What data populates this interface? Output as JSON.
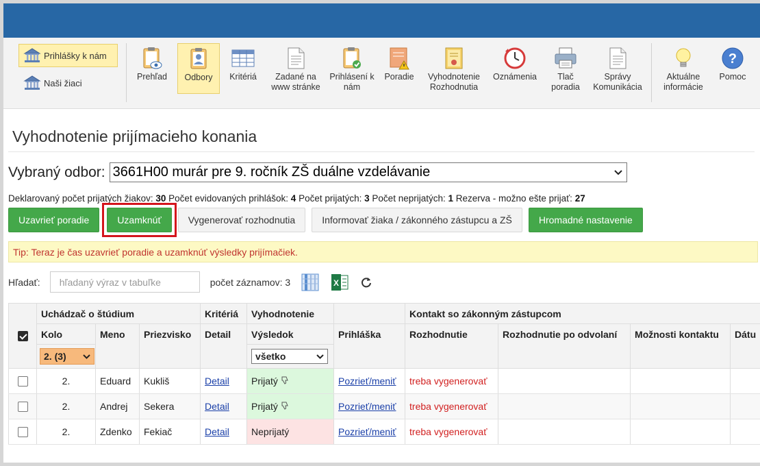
{
  "sidebar": {
    "items": [
      {
        "label": "Prihlášky k nám",
        "active": true
      },
      {
        "label": "Naši žiaci",
        "active": false
      }
    ]
  },
  "toolbar": {
    "items": [
      {
        "label": "Prehľad",
        "icon": "clipboard-eye-icon"
      },
      {
        "label": "Odbory",
        "icon": "clipboard-user-icon",
        "active": true
      },
      {
        "label": "Kritériá",
        "icon": "table-grid-icon"
      },
      {
        "label": "Zadané na www stránke",
        "icon": "document-icon"
      },
      {
        "label": "Prihlásení k nám",
        "icon": "clipboard-check-icon"
      },
      {
        "label": "Poradie",
        "icon": "warning-document-icon"
      },
      {
        "label": "Vyhodnotenie Rozhodnutia",
        "icon": "certificate-icon"
      },
      {
        "label": "Oznámenia",
        "icon": "clock-icon"
      },
      {
        "label": "Tlač poradia",
        "icon": "printer-icon"
      },
      {
        "label": "Správy Komunikácia",
        "icon": "document-icon"
      },
      {
        "label": "Aktuálne informácie",
        "icon": "lightbulb-icon"
      },
      {
        "label": "Pomoc",
        "icon": "help-icon"
      }
    ]
  },
  "page": {
    "title": "Vyhodnotenie prijímacieho konania",
    "odbor_label": "Vybraný odbor:",
    "odbor_value": "3661H00 murár pre 9. ročník ZŠ duálne vzdelávanie"
  },
  "stats": {
    "declared_label": "Deklarovaný počet prijatých žiakov:",
    "declared_value": "30",
    "evid_label": "Počet evidovaných prihlášok:",
    "evid_value": "4",
    "accepted_label": "Počet prijatých:",
    "accepted_value": "3",
    "rejected_label": "Počet neprijatých:",
    "rejected_value": "1",
    "reserve_label": "Rezerva - možno ešte prijať:",
    "reserve_value": "27"
  },
  "actions": {
    "close_order": "Uzavrieť poradie",
    "lock": "Uzamknúť",
    "generate": "Vygenerovať rozhodnutia",
    "inform": "Informovať žiaka / zákonného zástupcu a ZŠ",
    "bulk": "Hromadné nastavenie"
  },
  "tip": "Tip: Teraz je čas uzavrieť poradie a uzamknúť výsledky prijímačiek.",
  "search": {
    "label": "Hľadať:",
    "placeholder": "hľadaný výraz v tabuľke",
    "count_label": "počet záznamov: 3"
  },
  "table": {
    "group_headers": {
      "applicant": "Uchádzač o štúdium",
      "criteria": "Kritériá",
      "evaluation": "Vyhodnotenie",
      "contact": "Kontakt so zákonným zástupcom"
    },
    "columns": {
      "kolo": "Kolo",
      "meno": "Meno",
      "priezvisko": "Priezvisko",
      "detail": "Detail",
      "vysledok": "Výsledok",
      "prihlaska": "Prihláška",
      "rozhodnutie": "Rozhodnutie",
      "rozhodnutie_odvolani": "Rozhodnutie po odvolaní",
      "moznosti": "Možnosti kontaktu",
      "datum": "Dátu"
    },
    "filters": {
      "kolo": "2. (3)",
      "vysledok": "všetko"
    },
    "rows": [
      {
        "kolo": "2.",
        "meno": "Eduard",
        "priezvisko": "Kukliš",
        "detail": "Detail",
        "vysledok": "Prijatý",
        "status": "ok",
        "prihlaska": "Pozrieť/meniť",
        "rozhodnutie": "treba vygenerovať"
      },
      {
        "kolo": "2.",
        "meno": "Andrej",
        "priezvisko": "Sekera",
        "detail": "Detail",
        "vysledok": "Prijatý",
        "status": "ok",
        "prihlaska": "Pozrieť/meniť",
        "rozhodnutie": "treba vygenerovať"
      },
      {
        "kolo": "2.",
        "meno": "Zdenko",
        "priezvisko": "Fekiač",
        "detail": "Detail",
        "vysledok": "Neprijatý",
        "status": "bad",
        "prihlaska": "Pozrieť/meniť",
        "rozhodnutie": "treba vygenerovať"
      }
    ]
  },
  "colors": {
    "header_blue": "#2767a5",
    "green_button": "#44a84a",
    "highlight_red": "#d4141c",
    "accepted_bg": "#dcf8dd",
    "rejected_bg": "#fde3e3"
  }
}
